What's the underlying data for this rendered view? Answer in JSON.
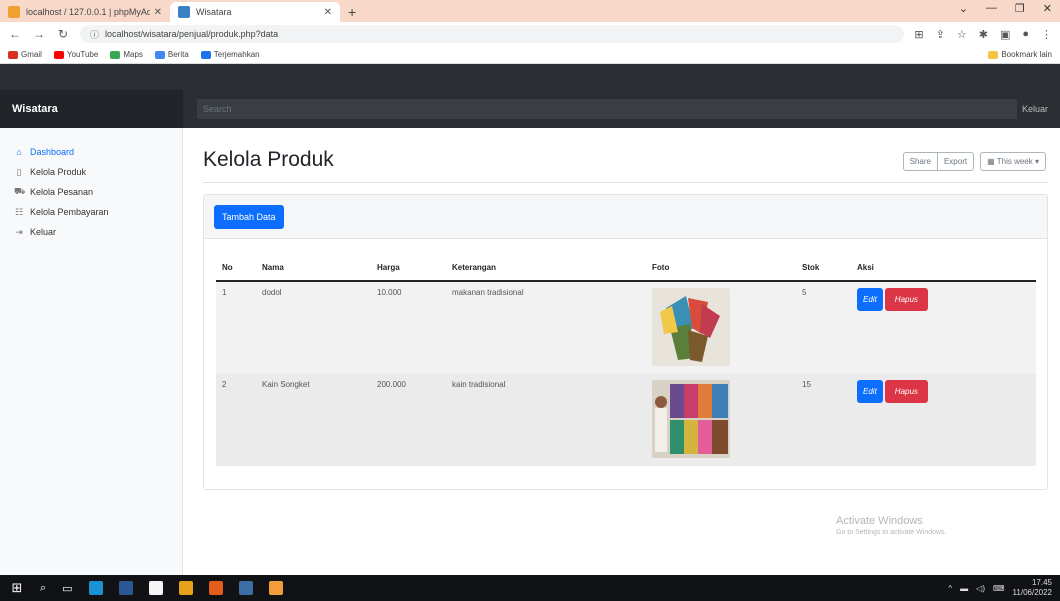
{
  "browser": {
    "tabs": [
      {
        "title": "localhost / 127.0.0.1 | phpMyAdm",
        "active": false
      },
      {
        "title": "Wisatara",
        "active": true
      }
    ],
    "new_tab": "+",
    "url": "localhost/wisatara/penjual/produk.php?data",
    "bookmarks": [
      "Gmail",
      "YouTube",
      "Maps",
      "Berita",
      "Terjemahkan"
    ],
    "bookmarks_right": "Bookmark lain"
  },
  "navbar": {
    "brand": "Wisatara",
    "search_placeholder": "Search",
    "signout": "Keluar"
  },
  "sidebar": {
    "items": [
      {
        "label": "Dashboard",
        "icon": "home-icon"
      },
      {
        "label": "Kelola Produk",
        "icon": "file-icon"
      },
      {
        "label": "Kelola Pesanan",
        "icon": "cart-icon"
      },
      {
        "label": "Kelola Pembayaran",
        "icon": "users-icon"
      },
      {
        "label": "Keluar",
        "icon": "logout-icon"
      }
    ]
  },
  "main": {
    "title": "Kelola Produk",
    "share": "Share",
    "export": "Export",
    "this_week": "This week",
    "add_button": "Tambah Data",
    "columns": [
      "No",
      "Nama",
      "Harga",
      "Keterangan",
      "Foto",
      "Stok",
      "Aksi"
    ],
    "rows": [
      {
        "no": "1",
        "nama": "dodol",
        "harga": "10.000",
        "keterangan": "makanan tradisional",
        "stok": "5"
      },
      {
        "no": "2",
        "nama": "Kain Songket",
        "harga": "200.000",
        "keterangan": "kain tradisional",
        "stok": "15"
      }
    ],
    "edit_label": "Edit",
    "delete_label": "Hapus"
  },
  "watermark": {
    "line1": "Activate Windows",
    "line2": "Go to Settings to activate Windows."
  },
  "taskbar": {
    "time": "17.45",
    "date": "11/06/2022"
  },
  "colors": {
    "primary": "#0d6efd",
    "danger": "#dc3545",
    "navbar": "#2b2f33",
    "brand_bg": "#212529"
  }
}
